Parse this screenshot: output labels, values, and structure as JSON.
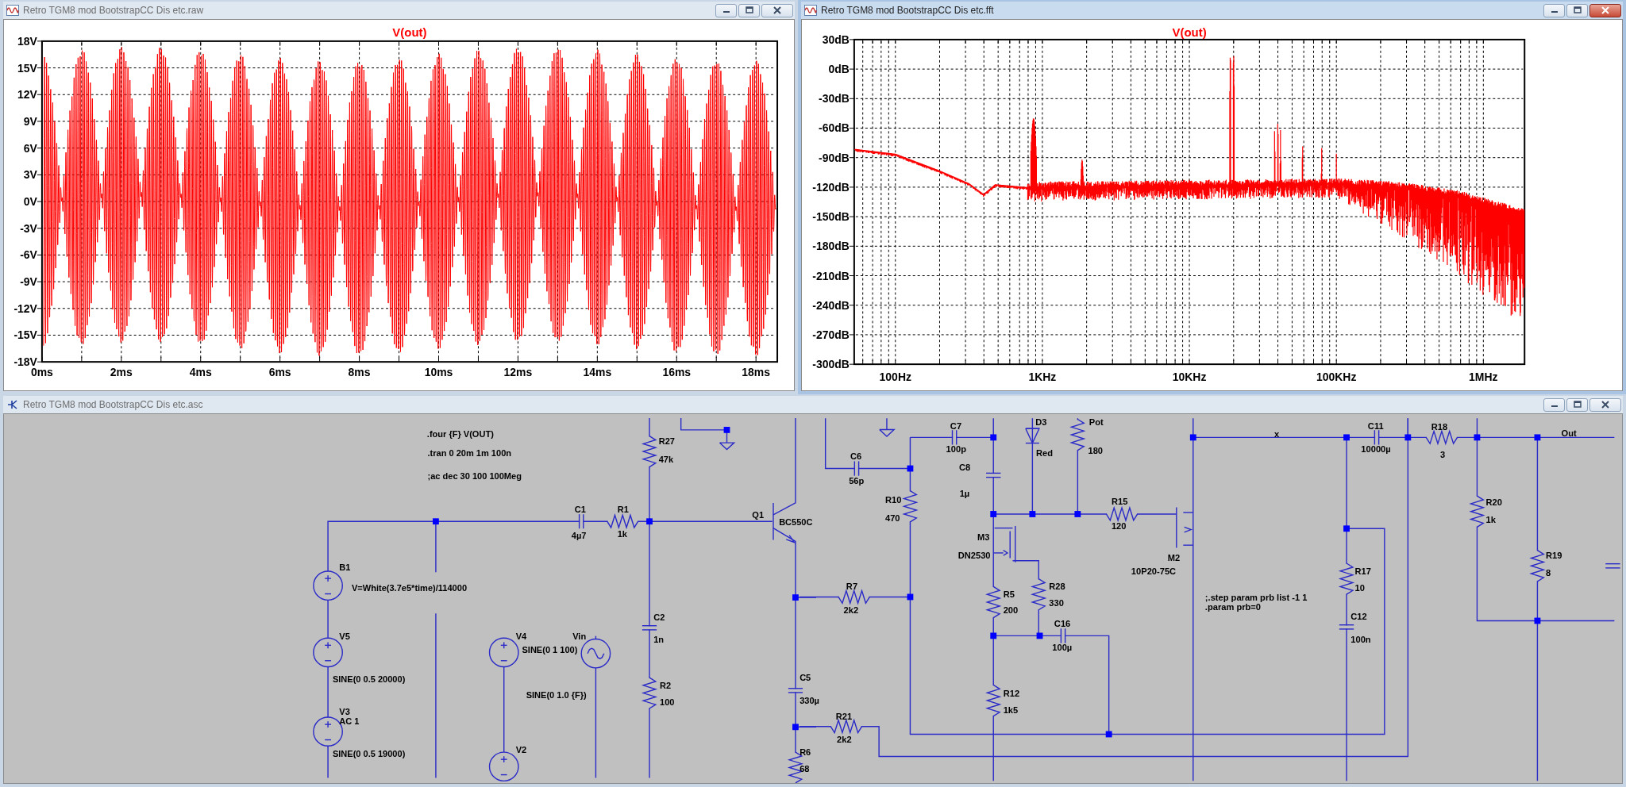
{
  "windows": [
    {
      "kind": "waveform",
      "title": "Retro TGM8 mod BootstrapCC Dis etc.raw",
      "active": false,
      "plot_title": "V(out)",
      "y_ticks": [
        "18V",
        "15V",
        "12V",
        "9V",
        "6V",
        "3V",
        "0V",
        "-3V",
        "-6V",
        "-9V",
        "-12V",
        "-15V",
        "-18V"
      ],
      "x_ticks": [
        "0ms",
        "2ms",
        "4ms",
        "6ms",
        "8ms",
        "10ms",
        "12ms",
        "14ms",
        "16ms",
        "18ms"
      ]
    },
    {
      "kind": "spectrum",
      "title": "Retro TGM8 mod BootstrapCC Dis etc.fft",
      "active": true,
      "plot_title": "V(out)",
      "y_ticks": [
        "30dB",
        "0dB",
        "-30dB",
        "-60dB",
        "-90dB",
        "-120dB",
        "-150dB",
        "-180dB",
        "-210dB",
        "-240dB",
        "-270dB",
        "-300dB"
      ],
      "x_ticks": [
        "100Hz",
        "1KHz",
        "10KHz",
        "100KHz",
        "1MHz"
      ]
    },
    {
      "kind": "schematic",
      "title": "Retro TGM8 mod BootstrapCC Dis etc.asc",
      "active": false,
      "labels": [
        ".four {F} V(OUT)",
        ".tran 0 20m 1m 100n",
        ";ac dec 30 100 100Meg",
        "R27",
        "47k",
        "C1",
        "4µ7",
        "R1",
        "1k",
        "Q1",
        "BC550C",
        "B1",
        "V=White(3.7e5*time)/114000",
        "V5",
        "SINE(0 0.5 20000)",
        "V3",
        "AC 1",
        "SINE(0 0.5 19000)",
        "V4",
        "SINE(0 1 100)",
        "Vin",
        "SINE(0 1.0 {F})",
        "V2",
        "C2",
        "1n",
        "R2",
        "100",
        "C5",
        "330µ",
        "R6",
        "68",
        "C6",
        "56p",
        "C7",
        "100p",
        "C8",
        "1µ",
        "R10",
        "470",
        "D3",
        "Red",
        "Pot",
        "180",
        "R15",
        "120",
        "M3",
        "DN2530",
        "R5",
        "200",
        "R28",
        "330",
        "C16",
        "100µ",
        "R12",
        "1k5",
        "R7",
        "2k2",
        "R21",
        "2k2",
        "M2",
        "10P20-75C",
        "x",
        "C11",
        "10000µ",
        "R18",
        "3",
        "R20",
        "1k",
        "R19",
        "8",
        "Out",
        "R17",
        "10",
        "C12",
        "100n",
        ";.step param prb list -1 1",
        ".param prb=0"
      ]
    }
  ]
}
